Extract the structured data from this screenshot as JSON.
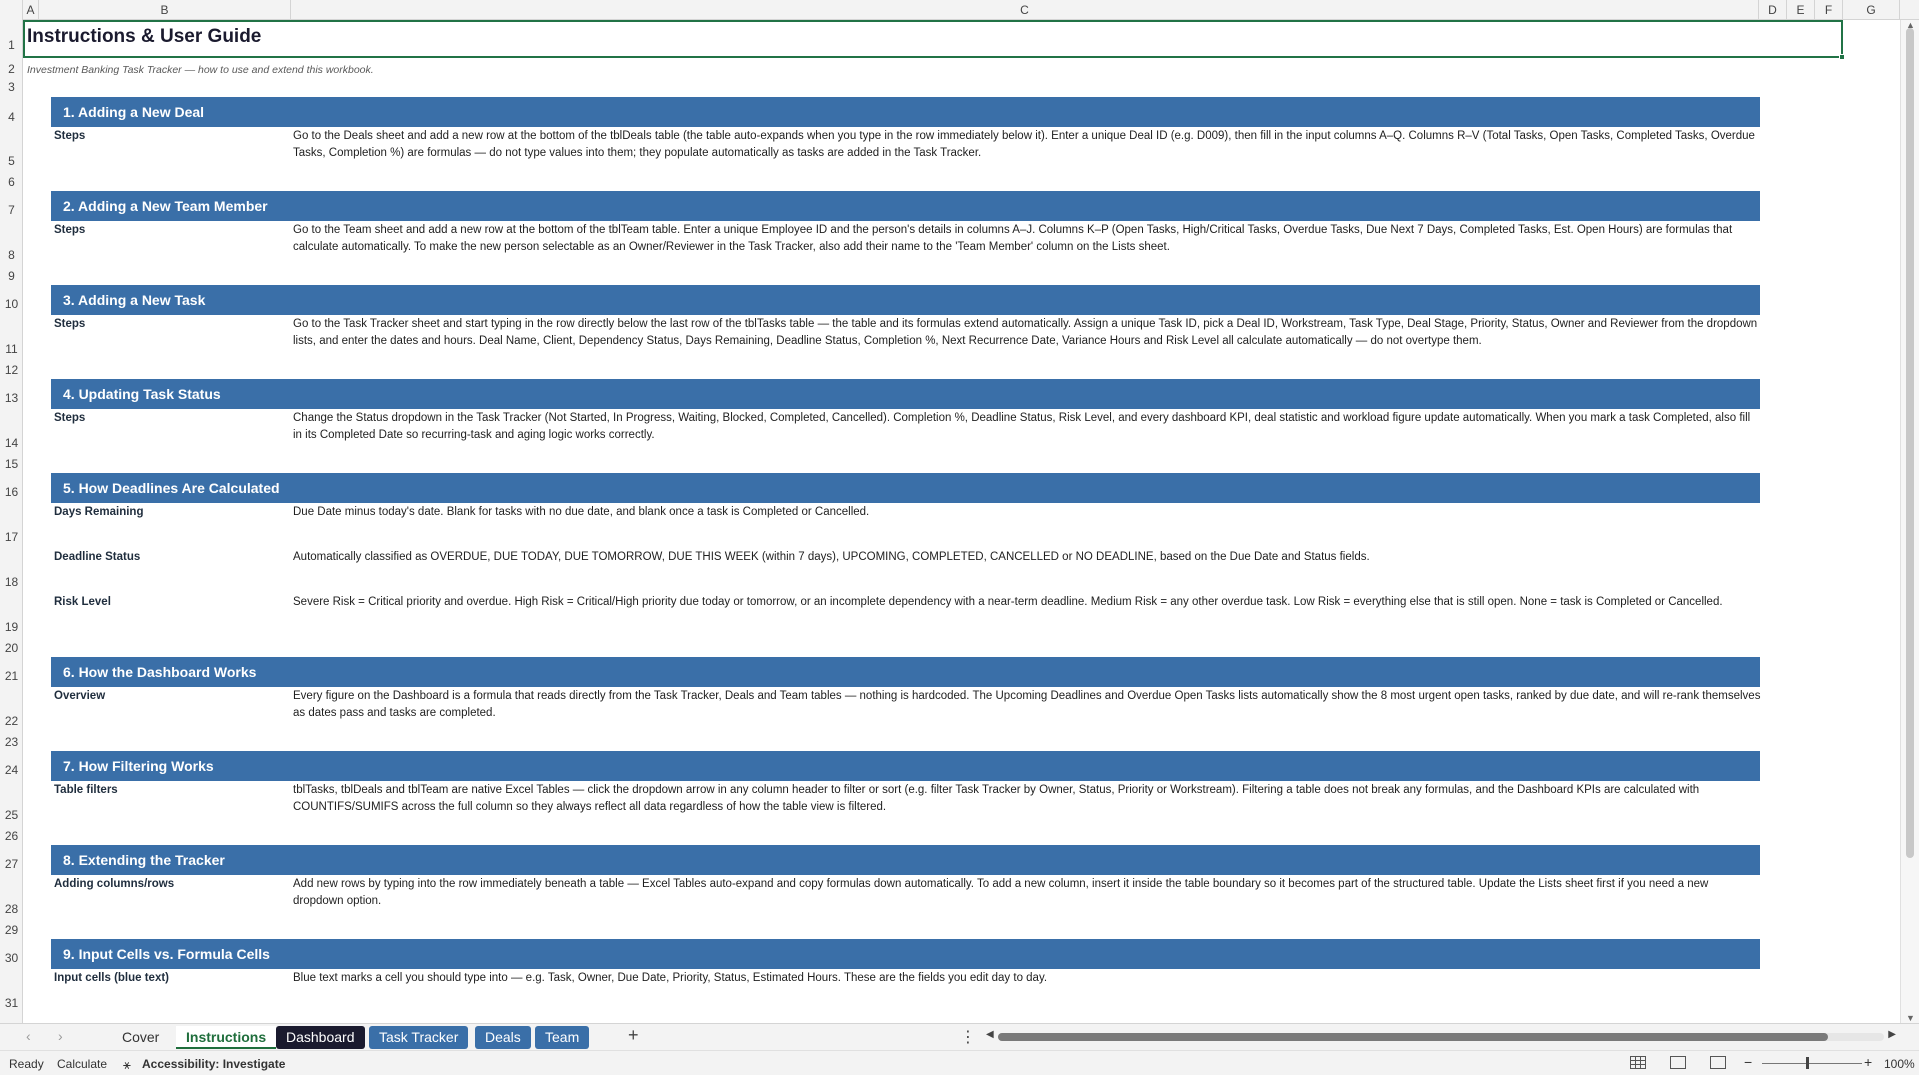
{
  "columns": [
    "A",
    "B",
    "C",
    "D",
    "E",
    "F",
    "G"
  ],
  "rows": [
    "1",
    "2",
    "3",
    "4",
    "5",
    "6",
    "7",
    "8",
    "9",
    "10",
    "11",
    "12",
    "13",
    "14",
    "15",
    "16",
    "17",
    "18",
    "19",
    "20",
    "21",
    "22",
    "23",
    "24",
    "25",
    "26",
    "27",
    "28",
    "29",
    "30",
    "31"
  ],
  "title": "Instructions & User Guide",
  "subtitle": "Investment Banking Task Tracker — how to use and extend this workbook.",
  "sections": [
    {
      "heading": "1. Adding a New Deal",
      "items": [
        {
          "label": "Steps",
          "text": "Go to the Deals sheet and add a new row at the bottom of the tblDeals table (the table auto-expands when you type in the row immediately below it). Enter a unique Deal ID (e.g. D009), then fill in the input columns A–Q. Columns R–V (Total Tasks, Open Tasks, Completed Tasks, Overdue Tasks, Completion %) are formulas — do not type values into them; they populate automatically as tasks are added in the Task Tracker."
        }
      ]
    },
    {
      "heading": "2. Adding a New Team Member",
      "items": [
        {
          "label": "Steps",
          "text": "Go to the Team sheet and add a new row at the bottom of the tblTeam table. Enter a unique Employee ID and the person's details in columns A–J. Columns K–P (Open Tasks, High/Critical Tasks, Overdue Tasks, Due Next 7 Days, Completed Tasks, Est. Open Hours) are formulas that calculate automatically. To make the new person selectable as an Owner/Reviewer in the Task Tracker, also add their name to the 'Team Member' column on the Lists sheet."
        }
      ]
    },
    {
      "heading": "3. Adding a New Task",
      "items": [
        {
          "label": "Steps",
          "text": "Go to the Task Tracker sheet and start typing in the row directly below the last row of the tblTasks table — the table and its formulas extend automatically. Assign a unique Task ID, pick a Deal ID, Workstream, Task Type, Deal Stage, Priority, Status, Owner and Reviewer from the dropdown lists, and enter the dates and hours. Deal Name, Client, Dependency Status, Days Remaining, Deadline Status, Completion %, Next Recurrence Date, Variance Hours and Risk Level all calculate automatically — do not overtype them."
        }
      ]
    },
    {
      "heading": "4. Updating Task Status",
      "items": [
        {
          "label": "Steps",
          "text": "Change the Status dropdown in the Task Tracker (Not Started, In Progress, Waiting, Blocked, Completed, Cancelled). Completion %, Deadline Status, Risk Level, and every dashboard KPI, deal statistic and workload figure update automatically. When you mark a task Completed, also fill in its Completed Date so recurring-task and aging logic works correctly."
        }
      ]
    },
    {
      "heading": "5. How Deadlines Are Calculated",
      "items": [
        {
          "label": "Days Remaining",
          "text": "Due Date minus today's date. Blank for tasks with no due date, and blank once a task is Completed or Cancelled."
        },
        {
          "label": "Deadline Status",
          "text": "Automatically classified as OVERDUE, DUE TODAY, DUE TOMORROW, DUE THIS WEEK (within 7 days), UPCOMING, COMPLETED, CANCELLED or NO DEADLINE, based on the Due Date and Status fields."
        },
        {
          "label": "Risk Level",
          "text": "Severe Risk = Critical priority and overdue. High Risk = Critical/High priority due today or tomorrow, or an incomplete dependency with a near-term deadline. Medium Risk = any other overdue task. Low Risk = everything else that is still open. None = task is Completed or Cancelled."
        }
      ]
    },
    {
      "heading": "6. How the Dashboard Works",
      "items": [
        {
          "label": "Overview",
          "text": "Every figure on the Dashboard is a formula that reads directly from the Task Tracker, Deals and Team tables — nothing is hardcoded. The Upcoming Deadlines and Overdue Open Tasks lists automatically show the 8 most urgent open tasks, ranked by due date, and will re-rank themselves as dates pass and tasks are completed."
        }
      ]
    },
    {
      "heading": "7. How Filtering Works",
      "items": [
        {
          "label": "Table filters",
          "text": "tblTasks, tblDeals and tblTeam are native Excel Tables — click the dropdown arrow in any column header to filter or sort (e.g. filter Task Tracker by Owner, Status, Priority or Workstream). Filtering a table does not break any formulas, and the Dashboard KPIs are calculated with COUNTIFS/SUMIFS across the full column so they always reflect all data regardless of how the table view is filtered."
        }
      ]
    },
    {
      "heading": "8. Extending the Tracker",
      "items": [
        {
          "label": "Adding columns/rows",
          "text": "Add new rows by typing into the row immediately beneath a table — Excel Tables auto-expand and copy formulas down automatically. To add a new column, insert it inside the table boundary so it becomes part of the structured table. Update the Lists sheet first if you need a new dropdown option."
        }
      ]
    },
    {
      "heading": "9. Input Cells vs. Formula Cells",
      "items": [
        {
          "label": "Input cells (blue text)",
          "text": "Blue text marks a cell you should type into — e.g. Task, Owner, Due Date, Priority, Status, Estimated Hours. These are the fields you edit day to day."
        }
      ]
    }
  ],
  "tabs": {
    "cover": "Cover",
    "instructions": "Instructions",
    "dashboard": "Dashboard",
    "task_tracker": "Task Tracker",
    "deals": "Deals",
    "team": "Team"
  },
  "status": {
    "ready": "Ready",
    "calculate": "Calculate",
    "accessibility": "Accessibility: Investigate",
    "zoom": "100%"
  },
  "colors": {
    "band": "#3a6fa8",
    "dashboard_tab": "#1a1a2e",
    "selection": "#217346"
  }
}
